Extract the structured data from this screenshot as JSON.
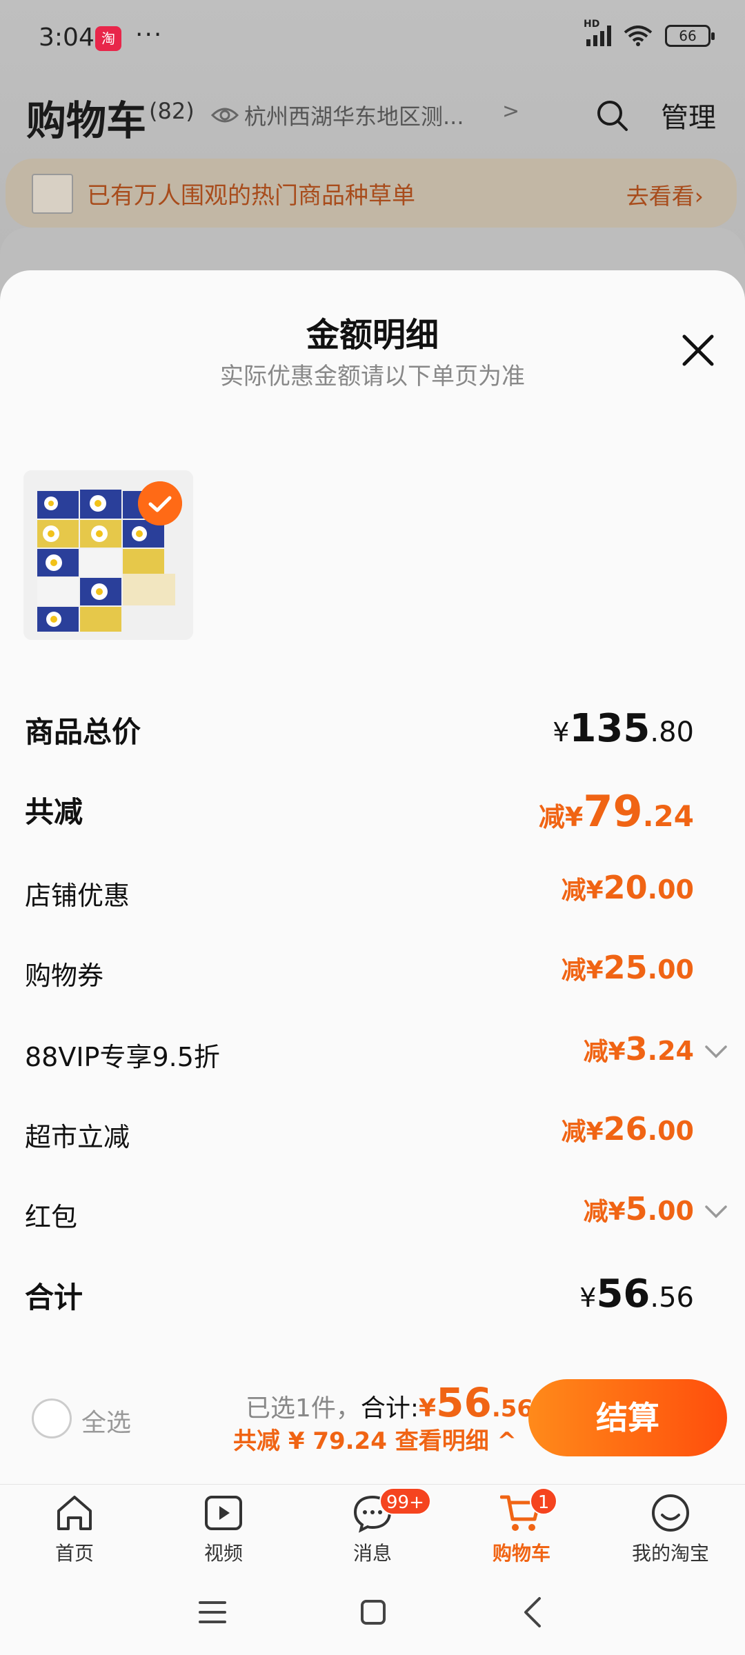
{
  "status_bar": {
    "time": "3:04",
    "app_badge": "淘",
    "dots": "···",
    "network": "HD",
    "battery": "66"
  },
  "cart": {
    "title": "购物车",
    "count": "(82)",
    "location": "杭州西湖华东地区测...",
    "location_chevron": ">",
    "manage": "管理",
    "promo_text": "已有万人围观的热门商品种草单",
    "promo_link": "去看看›"
  },
  "sheet": {
    "title": "金额明细",
    "subtitle": "实际优惠金额请以下单页为准",
    "rows": [
      {
        "label": "商品总价",
        "prefix": "¥",
        "int": "135",
        "dec": ".80"
      },
      {
        "label": "共减",
        "prefix": "减¥",
        "int": "79",
        "dec": ".24"
      },
      {
        "label": "店铺优惠",
        "prefix": "减¥",
        "int": "20",
        "dec": ".00"
      },
      {
        "label": "购物券",
        "prefix": "减¥",
        "int": "25",
        "dec": ".00"
      },
      {
        "label": "88VIP专享9.5折",
        "prefix": "减¥",
        "int": "3",
        "dec": ".24"
      },
      {
        "label": "超市立减",
        "prefix": "减¥",
        "int": "26",
        "dec": ".00"
      },
      {
        "label": "红包",
        "prefix": "减¥",
        "int": "5",
        "dec": ".00"
      },
      {
        "label": "合计",
        "prefix": "¥",
        "int": "56",
        "dec": ".56"
      }
    ]
  },
  "checkout": {
    "select_all": "全选",
    "selected": "已选1件，",
    "total_label": "合计:",
    "total_prefix": "¥",
    "total_int": "56",
    "total_dec": ".56",
    "saved": "共减 ¥ 79.24  查看明细 ^",
    "button": "结算"
  },
  "tabs": [
    {
      "label": "首页",
      "icon": "home-icon"
    },
    {
      "label": "视频",
      "icon": "video-icon"
    },
    {
      "label": "消息",
      "icon": "message-icon",
      "badge": "99+"
    },
    {
      "label": "购物车",
      "icon": "cart-icon",
      "badge": "1",
      "active": true
    },
    {
      "label": "我的淘宝",
      "icon": "profile-icon"
    }
  ],
  "colors": {
    "accent": "#f06414",
    "checkout_gradient_start": "#ff8a1a",
    "checkout_gradient_end": "#ff4e0c"
  }
}
